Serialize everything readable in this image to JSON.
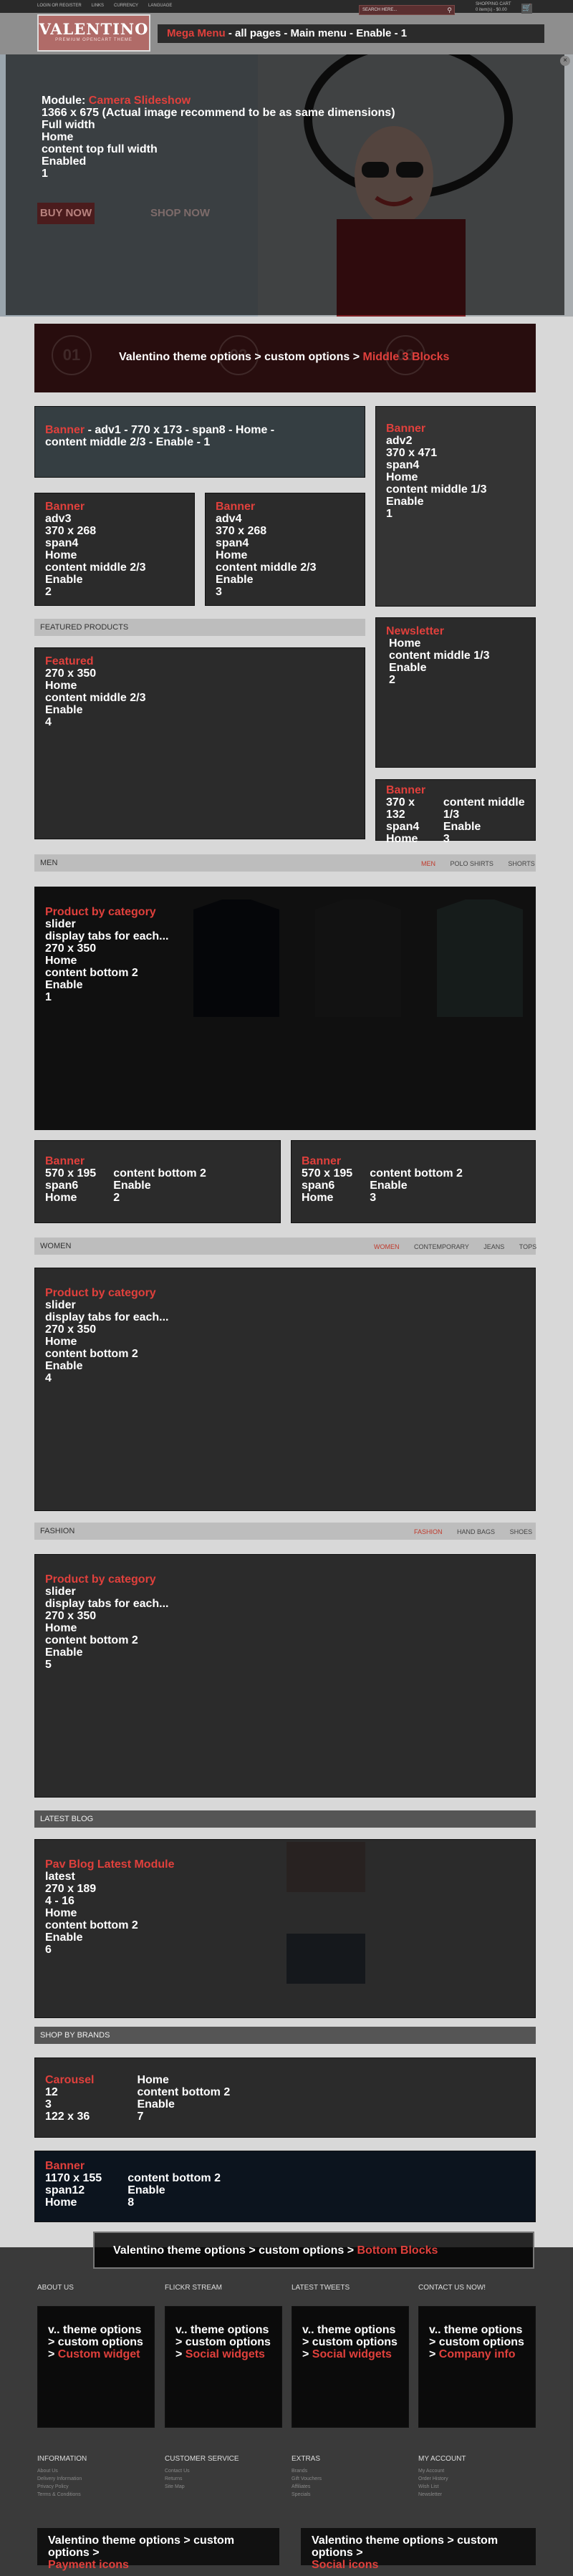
{
  "header": {
    "top_links": [
      "LOGIN OR REGISTER",
      "LINKS",
      "CURRENCY",
      "LANGUAGE"
    ],
    "logo": "VALENTINO",
    "logo_tagline": "PREMIUM OPENCART THEME",
    "search_placeholder": "SEARCH HERE...",
    "cart_title": "SHOPPING CART",
    "cart_info": "0 item(s) - $0.00",
    "megamenu": {
      "module": "Mega Menu",
      "text": " - all pages - Main menu -  Enable - 1"
    }
  },
  "slideshow": {
    "module_label": "Module: ",
    "module_name": "Camera Slideshow",
    "lines": [
      "1366 x 675 (Actual image recommend to be as same dimensions)",
      "Full width",
      "Home",
      "content top full width",
      "Enabled",
      "1"
    ],
    "bg_buttons": [
      "BUY NOW",
      "SHOP NOW"
    ],
    "bg_numbers": [
      "01",
      "02",
      "03"
    ]
  },
  "middle_blocks": {
    "text": "Valentino theme options > custom options > ",
    "link": "Middle 3 Blocks"
  },
  "banner_adv1": {
    "title": "Banner",
    "lines": [
      " - adv1 - 770 x 173 - span8 - Home -",
      "content middle 2/3 - Enable - 1"
    ]
  },
  "banner_adv2": {
    "title": "Banner",
    "lines": [
      "adv2",
      "370 x 471",
      "span4",
      "Home",
      "content middle 1/3",
      "Enable",
      "1"
    ]
  },
  "banner_adv3": {
    "title": "Banner",
    "lines": [
      "adv3",
      "370 x 268",
      "span4",
      "Home",
      "content middle 2/3",
      "Enable",
      "2"
    ]
  },
  "banner_adv4": {
    "title": "Banner",
    "lines": [
      "adv4",
      "370 x 268",
      "span4",
      "Home",
      "content middle 2/3",
      "Enable",
      "3"
    ]
  },
  "featured": {
    "section_title": "FEATURED PRODUCTS",
    "title": "Featured",
    "lines": [
      "270 x 350",
      "Home",
      "content middle 2/3",
      "Enable",
      "4"
    ]
  },
  "newsletter": {
    "title": "Newsletter",
    "lines": [
      "Home",
      "content middle 1/3",
      "Enable",
      "2"
    ]
  },
  "banner_small": {
    "title": "Banner",
    "col1": [
      "370 x 132",
      "span4",
      "Home"
    ],
    "col2": [
      "content middle 1/3",
      "Enable",
      "3"
    ]
  },
  "men": {
    "section_title": "MEN",
    "tabs": [
      "MEN",
      "POLO SHIRTS",
      "SHORTS"
    ],
    "title": "Product by category",
    "lines": [
      "slider",
      "display tabs for each...",
      "270 x 350",
      "Home",
      "content bottom 2",
      "Enable",
      "1"
    ]
  },
  "banner_b2": {
    "title": "Banner",
    "col1": [
      "570 x 195",
      "span6",
      "Home"
    ],
    "col2": [
      "content bottom 2",
      "Enable",
      "2"
    ]
  },
  "banner_b3": {
    "title": "Banner",
    "col1": [
      "570 x 195",
      "span6",
      "Home"
    ],
    "col2": [
      "content bottom 2",
      "Enable",
      "3"
    ]
  },
  "women": {
    "section_title": "WOMEN",
    "tabs": [
      "WOMEN",
      "CONTEMPORARY",
      "JEANS",
      "TOPS"
    ],
    "title": "Product by category",
    "lines": [
      "slider",
      "display tabs for each...",
      "270 x 350",
      "Home",
      "content bottom 2",
      "Enable",
      "4"
    ]
  },
  "fashion": {
    "section_title": "FASHION",
    "tabs": [
      "FASHION",
      "HAND BAGS",
      "SHOES"
    ],
    "title": "Product by category",
    "lines": [
      "slider",
      "display tabs for each...",
      "270 x 350",
      "Home",
      "content bottom 2",
      "Enable",
      "5"
    ]
  },
  "blog": {
    "section_title": "LATEST BLOG",
    "title": "Pav Blog Latest Module",
    "lines": [
      "latest",
      "270 x 189",
      "4 - 16",
      "Home",
      "content bottom 2",
      "Enable",
      "6"
    ]
  },
  "brands": {
    "section_title": "SHOP BY BRANDS",
    "title": "Carousel",
    "col1": [
      "12",
      "3",
      "122 x 36"
    ],
    "col2": [
      "Home",
      "content bottom 2",
      "Enable",
      "7"
    ]
  },
  "banner_full": {
    "title": "Banner",
    "col1": [
      "1170 x 155",
      "span12",
      "Home"
    ],
    "col2": [
      "content bottom 2",
      "Enable",
      "8"
    ]
  },
  "bottom_blocks": {
    "text": "Valentino theme options > custom options > ",
    "link": "Bottom Blocks"
  },
  "footer_top": {
    "columns": [
      {
        "title": "ABOUT US",
        "text": "v.. theme options > custom options > ",
        "link": "Custom widget"
      },
      {
        "title": "FLICKR STREAM",
        "text": "v.. theme options > custom options > ",
        "link": "Social widgets"
      },
      {
        "title": "LATEST TWEETS",
        "text": "v.. theme options > custom options > ",
        "link": "Social widgets"
      },
      {
        "title": "CONTACT US NOW!",
        "text": "v.. theme options > custom options > ",
        "link": "Company info"
      }
    ]
  },
  "footer_links": [
    {
      "title": "INFORMATION",
      "items": [
        "About Us",
        "Delivery Information",
        "Privacy Policy",
        "Terms & Conditions"
      ]
    },
    {
      "title": "CUSTOMER SERVICE",
      "items": [
        "Contact Us",
        "Returns",
        "Site Map"
      ]
    },
    {
      "title": "EXTRAS",
      "items": [
        "Brands",
        "Gift Vouchers",
        "Affiliates",
        "Specials"
      ]
    },
    {
      "title": "MY ACCOUNT",
      "items": [
        "My Account",
        "Order History",
        "Wish List",
        "Newsletter"
      ]
    }
  ],
  "payment": {
    "text": "Valentino theme options > custom options > ",
    "link": "Payment icons"
  },
  "social": {
    "text": "Valentino theme options > custom options > ",
    "link": "Social icons"
  }
}
